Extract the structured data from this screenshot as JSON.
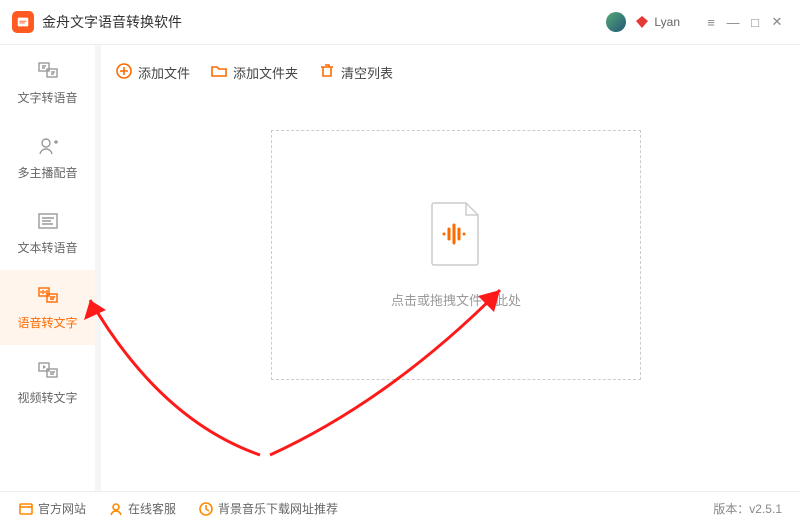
{
  "titlebar": {
    "app_title": "金舟文字语音转换软件",
    "username": "Lyan"
  },
  "sidebar": {
    "items": [
      {
        "id": "text-to-speech",
        "label": "文字转语音"
      },
      {
        "id": "multi-voice",
        "label": "多主播配音"
      },
      {
        "id": "text-tts",
        "label": "文本转语音"
      },
      {
        "id": "speech-to-text",
        "label": "语音转文字"
      },
      {
        "id": "video-to-text",
        "label": "视频转文字"
      }
    ],
    "active_index": 3
  },
  "toolbar": {
    "add_file_label": "添加文件",
    "add_folder_label": "添加文件夹",
    "clear_label": "清空列表"
  },
  "dropzone": {
    "hint": "点击或拖拽文件至此处"
  },
  "footer": {
    "official_site_label": "官方网站",
    "online_service_label": "在线客服",
    "bgm_label": "背景音乐下载网址推荐",
    "version_prefix": "版本：",
    "version_value": "v2.5.1"
  }
}
